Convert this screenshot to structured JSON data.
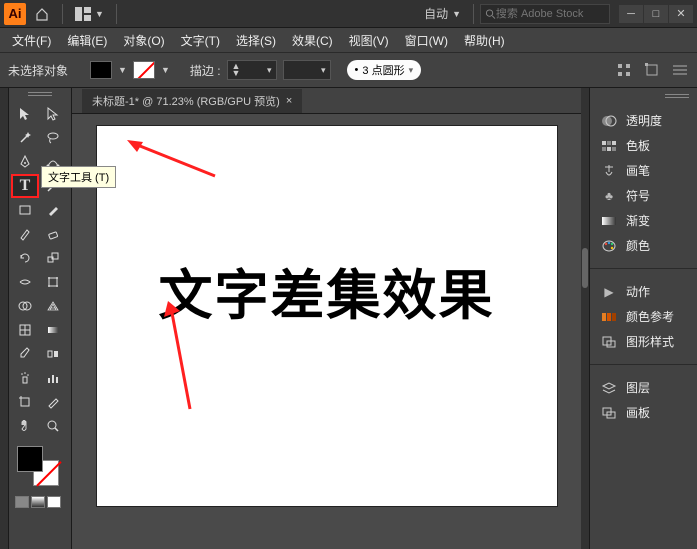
{
  "app": {
    "logo": "Ai"
  },
  "titlebar": {
    "layout_label": "自动",
    "search_placeholder": "搜索 Adobe Stock"
  },
  "menu": {
    "file": "文件(F)",
    "edit": "编辑(E)",
    "object": "对象(O)",
    "type": "文字(T)",
    "select": "选择(S)",
    "effect": "效果(C)",
    "view": "视图(V)",
    "window": "窗口(W)",
    "help": "帮助(H)"
  },
  "control": {
    "no_selection": "未选择对象",
    "stroke_label": "描边 :",
    "stroke_value": "",
    "brush_style": "3 点圆形",
    "brush_bullet": "•"
  },
  "document": {
    "tab_title": "未标题-1* @ 71.23% (RGB/GPU 预览)",
    "close": "×",
    "canvas_text": "文字差集效果"
  },
  "tooltip": {
    "type_tool": "文字工具 (T)"
  },
  "panels": {
    "transparency": "透明度",
    "swatches": "色板",
    "brushes": "画笔",
    "symbols": "符号",
    "gradient": "渐变",
    "color": "颜色",
    "actions": "动作",
    "color_guide": "颜色参考",
    "graphic_styles": "图形样式",
    "layers": "图层",
    "artboards": "画板"
  }
}
